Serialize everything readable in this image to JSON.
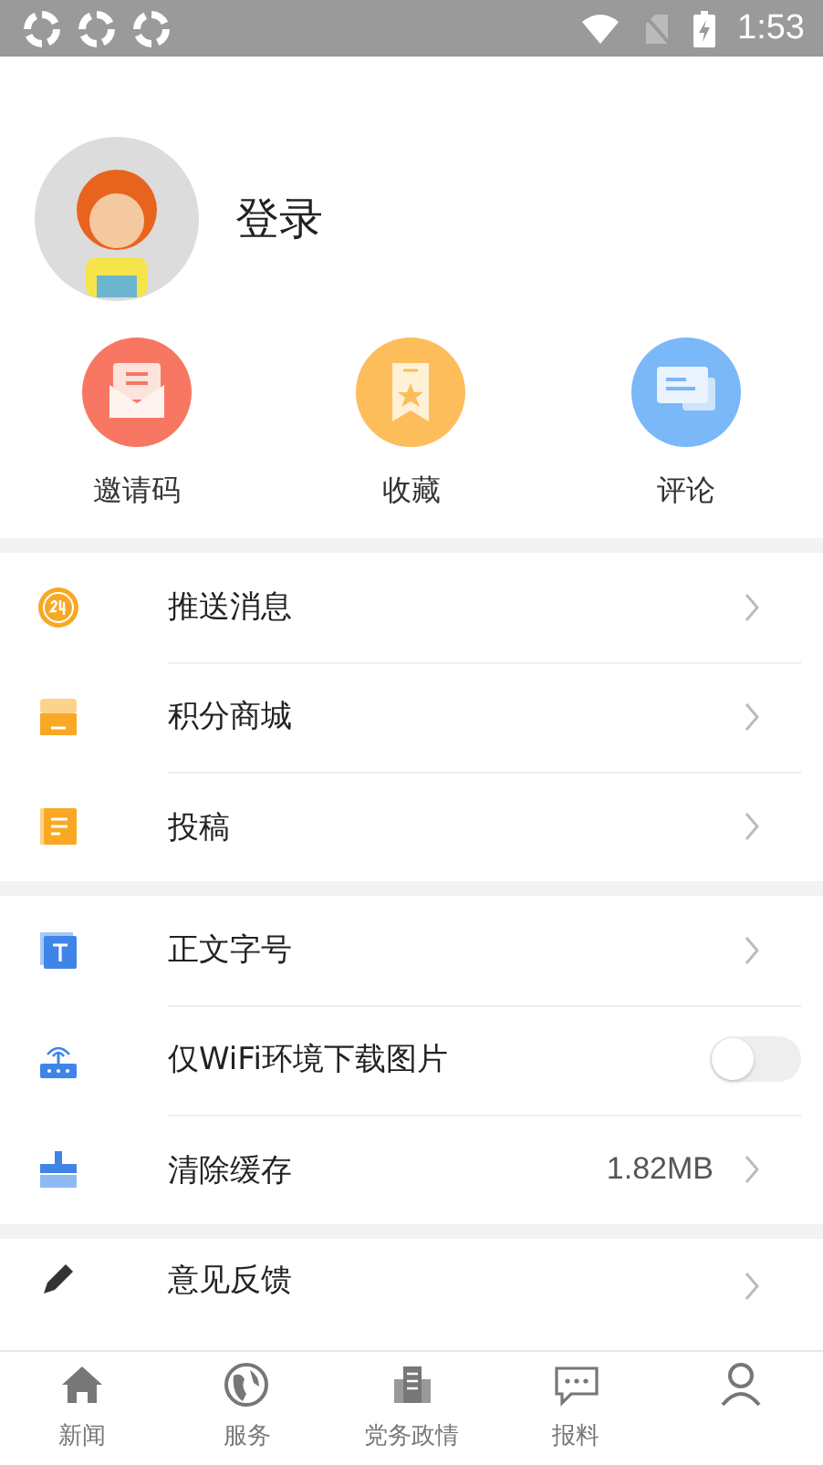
{
  "status_bar": {
    "time": "1:53"
  },
  "profile": {
    "login_label": "登录"
  },
  "quick_actions": [
    {
      "label": "邀请码",
      "kind": "invite",
      "color": "#f87762"
    },
    {
      "label": "收藏",
      "kind": "favorite",
      "color": "#fdbd5a"
    },
    {
      "label": "评论",
      "kind": "comment",
      "color": "#7ab8f8"
    }
  ],
  "menu_groups": [
    [
      {
        "label": "推送消息",
        "kind": "push"
      },
      {
        "label": "积分商城",
        "kind": "shop"
      },
      {
        "label": "投稿",
        "kind": "submit"
      }
    ],
    [
      {
        "label": "正文字号",
        "kind": "font"
      },
      {
        "label": "仅WiFi环境下载图片",
        "kind": "wifi",
        "on": false
      },
      {
        "label": "清除缓存",
        "kind": "cache",
        "value": "1.82MB"
      }
    ],
    [
      {
        "label": "意见反馈",
        "kind": "feedback"
      }
    ]
  ],
  "bottom_nav": [
    {
      "label": "新闻",
      "kind": "home"
    },
    {
      "label": "服务",
      "kind": "globe"
    },
    {
      "label": "党务政情",
      "kind": "building"
    },
    {
      "label": "报料",
      "kind": "chat"
    },
    {
      "kind": "person"
    }
  ]
}
